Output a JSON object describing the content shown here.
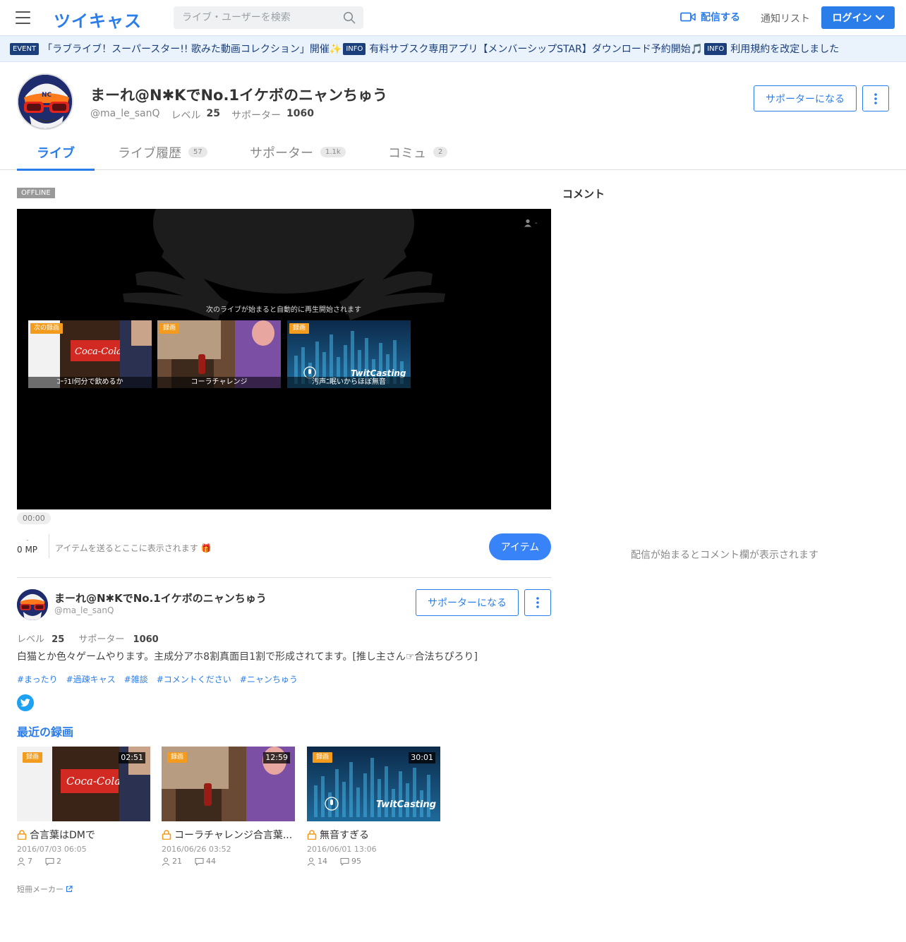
{
  "header": {
    "logo": "ツイキャス",
    "search_placeholder": "ライブ・ユーザーを検索",
    "broadcast_label": "配信する",
    "notifications_label": "通知リスト",
    "login_label": "ログイン"
  },
  "infobar": {
    "items": [
      {
        "badge": "EVENT",
        "text": "「ラブライブ！スーパースター!! 歌みた動画コレクション」開催✨"
      },
      {
        "badge": "INFO",
        "text": "有料サブスク専用アプリ【メンバーシップSTAR】ダウンロード予約開始🎵"
      },
      {
        "badge": "INFO",
        "text": "利用規約を改定しました"
      }
    ]
  },
  "profile": {
    "name": "まーれ@N✱KでNo.1イケボのニャンちゅう",
    "handle": "@ma_le_sanQ",
    "level_label": "レベル",
    "level": "25",
    "supporter_label": "サポーター",
    "supporters": "1060",
    "supporter_button": "サポーターになる"
  },
  "tabs": [
    {
      "label": "ライブ",
      "count": ""
    },
    {
      "label": "ライブ履歴",
      "count": "57"
    },
    {
      "label": "サポーター",
      "count": "1.1k"
    },
    {
      "label": "コミュ",
      "count": "2"
    }
  ],
  "player": {
    "status": "OFFLINE",
    "viewers": "-",
    "next_message": "次のライブが始まると自動的に再生開始されます",
    "thumbs": [
      {
        "tag": "次の録画",
        "title": "ｺｰﾗ1l何分で飲めるか"
      },
      {
        "tag": "録画",
        "title": "コーラチャレンジ"
      },
      {
        "tag": "録画",
        "title": "汚声ﾆ眠いからほぼ無音"
      }
    ],
    "time": "00:00",
    "mp_dash": "-",
    "mp": "0 MP",
    "item_message": "アイテムを送るとここに表示されます 🎁",
    "item_button": "アイテム"
  },
  "about": {
    "name": "まーれ@N✱KでNo.1イケボのニャンちゅう",
    "handle": "@ma_le_sanQ",
    "level_label": "レベル",
    "level": "25",
    "supporter_label": "サポーター",
    "supporters": "1060",
    "supporter_button": "サポーターになる",
    "bio": "白猫とか色々ゲームやります。主成分アホ8割真面目1割で形成されてます。[推し主さん☞合法ちぴろり]",
    "hashtags": [
      "#まったり",
      "#過疎キャス",
      "#雑談",
      "#コメントください",
      "#ニャンちゅう"
    ]
  },
  "recent": {
    "title": "最近の録画",
    "items": [
      {
        "tag": "録画",
        "duration": "02:51",
        "title": "合言葉はDMで",
        "date": "2016/07/03 06:05",
        "viewers": "7",
        "comments": "2"
      },
      {
        "tag": "録画",
        "duration": "12:59",
        "title": "コーラチャレンジ合言葉...",
        "date": "2016/06/26 03:52",
        "viewers": "21",
        "comments": "44"
      },
      {
        "tag": "録画",
        "duration": "30:01",
        "title": "無音すぎる",
        "date": "2016/06/01 13:06",
        "viewers": "14",
        "comments": "95"
      }
    ],
    "tanzaku": "短冊メーカー"
  },
  "comments": {
    "title": "コメント",
    "empty": "配信が始まるとコメント欄が表示されます"
  },
  "colors": {
    "accent": "#2b7de9",
    "badge_bg": "#1b3f7a",
    "orange_tag": "#f29b1d"
  }
}
